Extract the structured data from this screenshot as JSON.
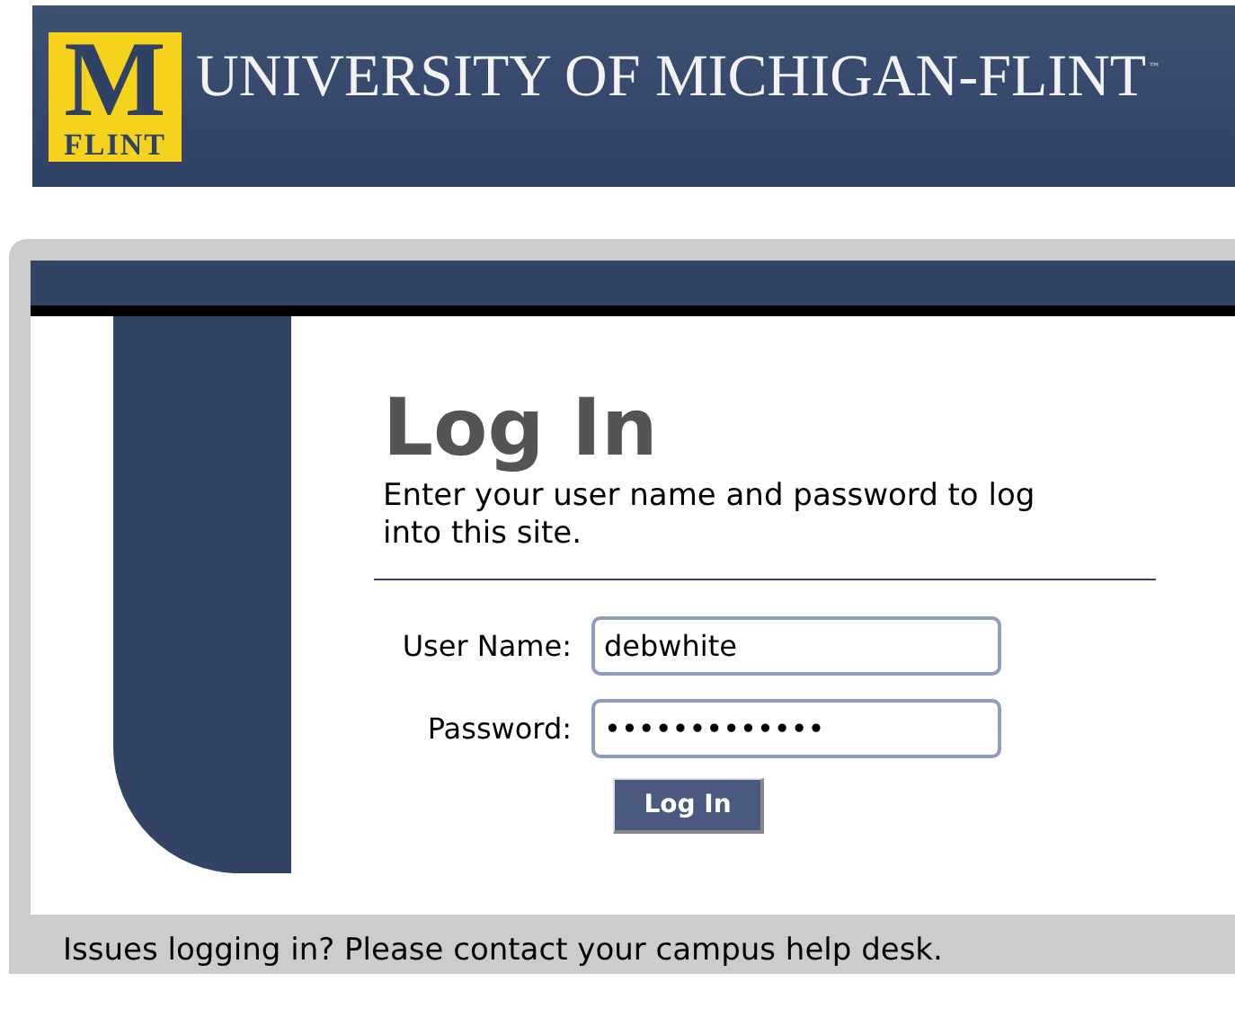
{
  "header": {
    "logo_letter": "M",
    "logo_caption": "FLINT",
    "title": "UNIVERSITY OF MICHIGAN-FLINT",
    "trademark": "™"
  },
  "login": {
    "title": "Log In",
    "instructions": "Enter your user name and password to log into this site.",
    "fields": [
      {
        "label": "User Name:",
        "value": "debwhite"
      },
      {
        "label": "Password:",
        "value": "•••••••••••••"
      }
    ],
    "button": "Log In"
  },
  "footer": {
    "text": "Issues logging in? Please contact your campus help desk."
  }
}
